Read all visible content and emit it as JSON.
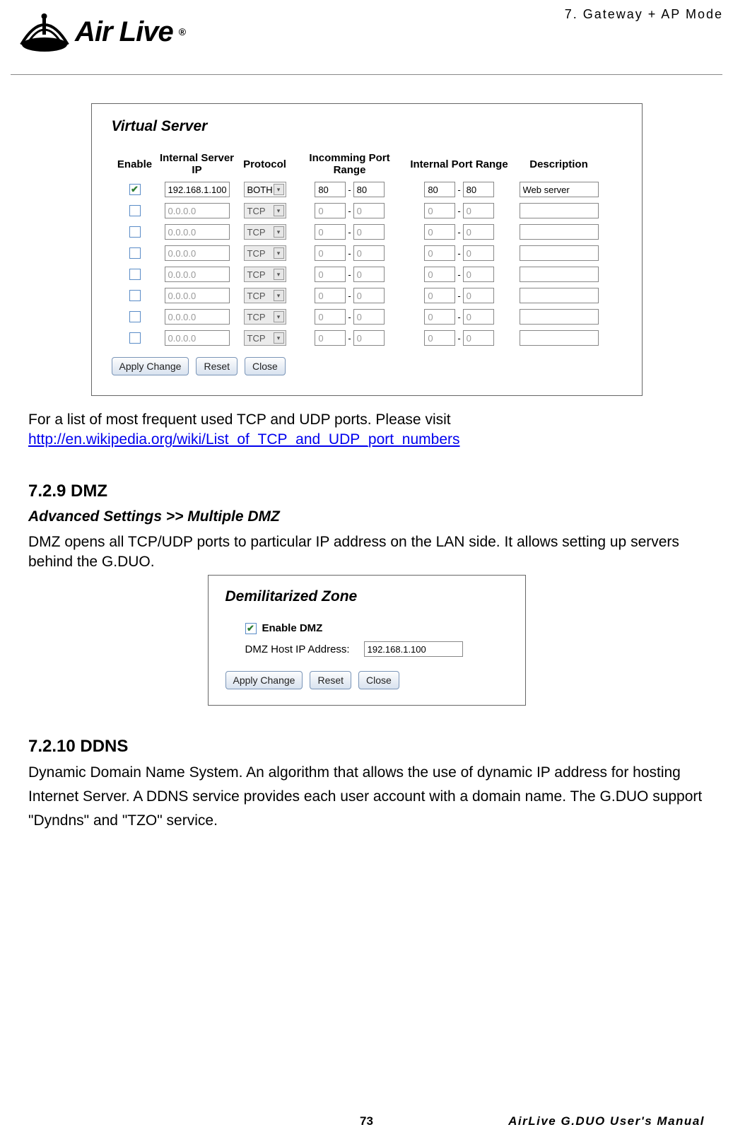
{
  "header": {
    "chapter": "7. Gateway + AP  Mode",
    "logo_text": "Air Live",
    "logo_reg": "®"
  },
  "virtualServer": {
    "title": "Virtual Server",
    "headers": {
      "enable": "Enable",
      "ip": "Internal Server IP",
      "protocol": "Protocol",
      "inport": "Incomming Port Range",
      "intport": "Internal Port Range",
      "desc": "Description"
    },
    "rows": [
      {
        "enabled": true,
        "ip": "192.168.1.100",
        "protocol": "BOTH",
        "in_from": "80",
        "in_to": "80",
        "int_from": "80",
        "int_to": "80",
        "desc": "Web server"
      },
      {
        "enabled": false,
        "ip": "0.0.0.0",
        "protocol": "TCP",
        "in_from": "0",
        "in_to": "0",
        "int_from": "0",
        "int_to": "0",
        "desc": ""
      },
      {
        "enabled": false,
        "ip": "0.0.0.0",
        "protocol": "TCP",
        "in_from": "0",
        "in_to": "0",
        "int_from": "0",
        "int_to": "0",
        "desc": ""
      },
      {
        "enabled": false,
        "ip": "0.0.0.0",
        "protocol": "TCP",
        "in_from": "0",
        "in_to": "0",
        "int_from": "0",
        "int_to": "0",
        "desc": ""
      },
      {
        "enabled": false,
        "ip": "0.0.0.0",
        "protocol": "TCP",
        "in_from": "0",
        "in_to": "0",
        "int_from": "0",
        "int_to": "0",
        "desc": ""
      },
      {
        "enabled": false,
        "ip": "0.0.0.0",
        "protocol": "TCP",
        "in_from": "0",
        "in_to": "0",
        "int_from": "0",
        "int_to": "0",
        "desc": ""
      },
      {
        "enabled": false,
        "ip": "0.0.0.0",
        "protocol": "TCP",
        "in_from": "0",
        "in_to": "0",
        "int_from": "0",
        "int_to": "0",
        "desc": ""
      },
      {
        "enabled": false,
        "ip": "0.0.0.0",
        "protocol": "TCP",
        "in_from": "0",
        "in_to": "0",
        "int_from": "0",
        "int_to": "0",
        "desc": ""
      }
    ],
    "buttons": {
      "apply": "Apply Change",
      "reset": "Reset",
      "close": "Close"
    }
  },
  "portsNote": {
    "line1": "For a list of most frequent used TCP and UDP ports.    Please visit",
    "link": "http://en.wikipedia.org/wiki/List_of_TCP_and_UDP_port_numbers"
  },
  "dmzSection": {
    "heading": "7.2.9 DMZ",
    "path": "Advanced Settings >> Multiple DMZ",
    "body": "DMZ opens all TCP/UDP ports to particular IP address on the LAN side.    It allows setting up servers behind the G.DUO."
  },
  "dmzPanel": {
    "title": "Demilitarized Zone",
    "enableLabel": "Enable DMZ",
    "enabled": true,
    "ipLabel": "DMZ Host IP Address:",
    "ipValue": "192.168.1.100",
    "buttons": {
      "apply": "Apply Change",
      "reset": "Reset",
      "close": "Close"
    }
  },
  "ddnsSection": {
    "heading": "7.2.10 DDNS",
    "body": "Dynamic Domain Name System.    An algorithm that allows the use of dynamic IP address for hosting Internet Server.    A DDNS service provides each user account with a domain name.    The G.DUO support \"Dyndns\" and \"TZO\" service."
  },
  "footer": {
    "page": "73",
    "right": "AirLive G.DUO User's Manual"
  },
  "glyphs": {
    "check": "✔",
    "down": "▾",
    "dash": "-"
  }
}
